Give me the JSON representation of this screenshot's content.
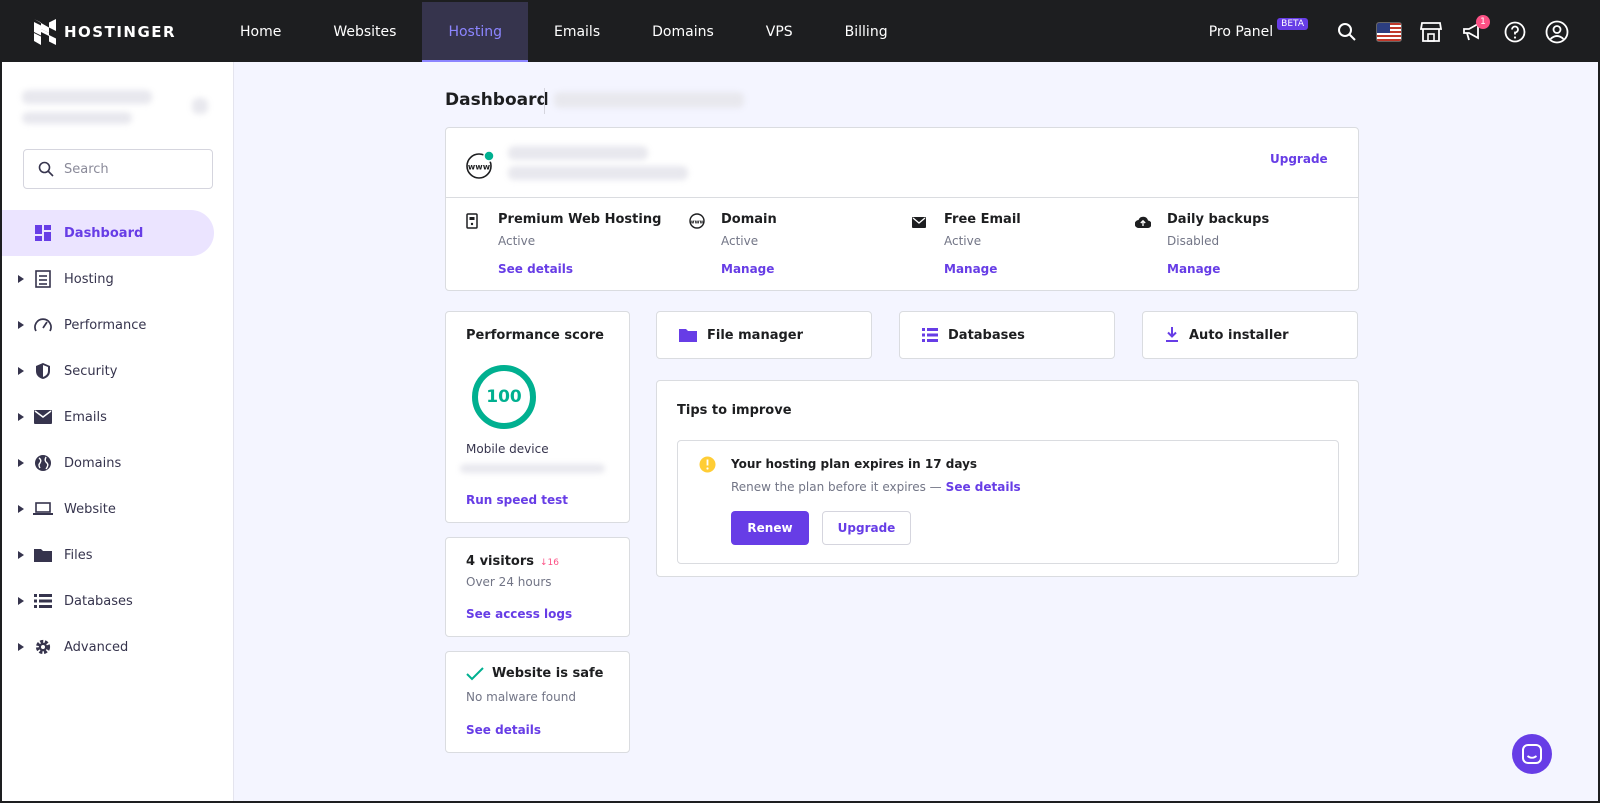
{
  "brand": {
    "name": "HOSTINGER"
  },
  "nav": {
    "items": [
      {
        "label": "Home"
      },
      {
        "label": "Websites"
      },
      {
        "label": "Hosting"
      },
      {
        "label": "Emails"
      },
      {
        "label": "Domains"
      },
      {
        "label": "VPS"
      },
      {
        "label": "Billing"
      }
    ],
    "active_index": 2,
    "pro_panel": "Pro Panel",
    "beta": "BETA",
    "notification_count": "1"
  },
  "sidebar": {
    "search_placeholder": "Search",
    "items": [
      {
        "label": "Dashboard",
        "icon": "dashboard-icon"
      },
      {
        "label": "Hosting",
        "icon": "server-icon"
      },
      {
        "label": "Performance",
        "icon": "speedometer-icon"
      },
      {
        "label": "Security",
        "icon": "shield-icon"
      },
      {
        "label": "Emails",
        "icon": "envelope-icon"
      },
      {
        "label": "Domains",
        "icon": "globe-icon"
      },
      {
        "label": "Website",
        "icon": "laptop-icon"
      },
      {
        "label": "Files",
        "icon": "folder-icon"
      },
      {
        "label": "Databases",
        "icon": "database-icon"
      },
      {
        "label": "Advanced",
        "icon": "gear-icon"
      }
    ]
  },
  "page": {
    "title": "Dashboard"
  },
  "overview": {
    "upgrade_label": "Upgrade",
    "services": [
      {
        "title": "Premium Web Hosting",
        "status": "Active",
        "action": "See details",
        "icon": "hosting-icon"
      },
      {
        "title": "Domain",
        "status": "Active",
        "action": "Manage",
        "icon": "www-icon"
      },
      {
        "title": "Free Email",
        "status": "Active",
        "action": "Manage",
        "icon": "envelope-icon"
      },
      {
        "title": "Daily backups",
        "status": "Disabled",
        "action": "Manage",
        "icon": "cloud-upload-icon"
      }
    ]
  },
  "performance": {
    "title": "Performance score",
    "score": "100",
    "score_value": 100,
    "device": "Mobile device",
    "action": "Run speed test",
    "color": "#00b090"
  },
  "visitors": {
    "count_label": "4 visitors",
    "change": "16",
    "period": "Over 24 hours",
    "action": "See access logs"
  },
  "safety": {
    "title": "Website is safe",
    "subtitle": "No malware found",
    "action": "See details"
  },
  "quick_actions": [
    {
      "label": "File manager",
      "icon": "folder-icon"
    },
    {
      "label": "Databases",
      "icon": "database-icon"
    },
    {
      "label": "Auto installer",
      "icon": "download-icon"
    }
  ],
  "tips": {
    "title": "Tips to improve",
    "alert_title": "Your hosting plan expires in 17 days",
    "alert_text": "Renew the plan before it expires —",
    "alert_link": "See details",
    "renew_label": "Renew",
    "upgrade_label": "Upgrade"
  },
  "colors": {
    "accent": "#673de6",
    "topbar": "#1d1e20",
    "success": "#00b090",
    "warning": "#ffcd35",
    "danger": "#fc5185"
  }
}
